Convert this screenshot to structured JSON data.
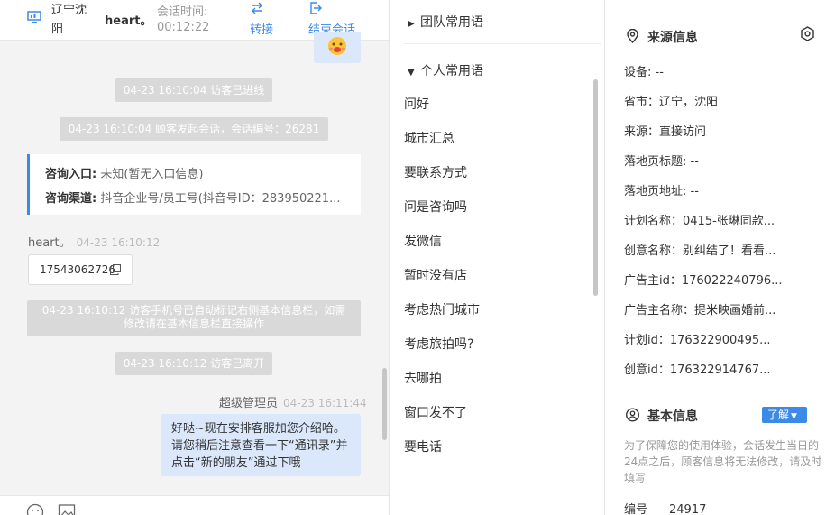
{
  "header": {
    "location": "辽宁沈阳",
    "visitor_name": "heart。",
    "session_time_label": "会话时间:",
    "session_time_value": "00:12:22",
    "transfer_label": "转接",
    "end_label": "结束会话"
  },
  "chat": {
    "sys1": "04-23 16:10:04 访客已进线",
    "sys2": "04-23 16:10:04 顾客发起会话，会话编号：26281",
    "card": {
      "entry_label": "咨询入口:",
      "entry_value": "未知(暂无入口信息)",
      "channel_label": "咨询渠道:",
      "channel_value": "抖音企业号/员工号(抖音号ID：283950221..."
    },
    "visitor_msg_name": "heart。",
    "visitor_msg_time": "04-23 16:10:12",
    "phone": "17543062726",
    "sys3_line1": "04-23 16:10:12 访客手机号已自动标记右侧基本信息栏，如需",
    "sys3_line2": "修改请在基本信息栏直接操作",
    "sys4": "04-23 16:10:12 访客已离开",
    "agent_name": "超级管理员",
    "agent_time": "04-23 16:11:44",
    "agent_msg_1": "好哒~现在安排客服加您介绍哈。",
    "agent_msg_2": "请您稍后注意查看一下“通讯录”并",
    "agent_msg_3": "点击“新的朋友”通过下哦"
  },
  "phrases": {
    "team_group": "团队常用语",
    "personal_group": "个人常用语",
    "items": [
      "问好",
      "城市汇总",
      "要联系方式",
      "问是咨询吗",
      "发微信",
      "暂时没有店",
      "考虑热门城市",
      "考虑旅拍吗?",
      "去哪拍",
      "窗口发不了",
      "要电话"
    ]
  },
  "source": {
    "title": "来源信息",
    "rows": [
      "设备: --",
      "省市：辽宁，沈阳",
      "来源：直接访问",
      "落地页标题: --",
      "落地页地址: --",
      "计划名称：0415-张琳同款...",
      "创意名称：别纠结了！看看...",
      "广告主id：176022240796...",
      "广告主名称：提米映画婚前...",
      "计划id：176322900495...",
      "创意id：176322914767..."
    ]
  },
  "basic": {
    "title": "基本信息",
    "learn_label": "了解",
    "notice": "为了保障您的使用体验，会话发生当日的24点之后，顾客信息将无法修改，请及时填写",
    "id_label": "编号",
    "id_value": "24917"
  },
  "colors": {
    "accent": "#3b8ae8",
    "bubble": "#dbe8fb",
    "system": "#d9d9d9"
  }
}
